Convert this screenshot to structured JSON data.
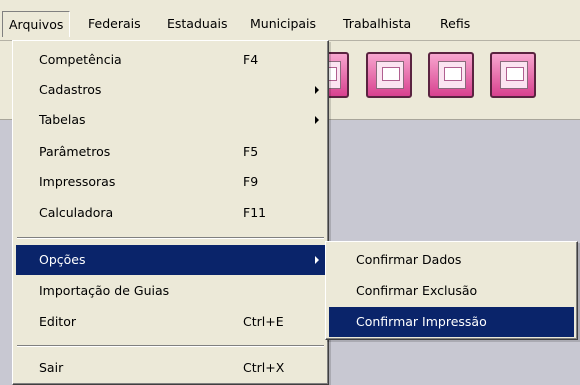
{
  "menubar": {
    "items": [
      {
        "label": "Arquivos"
      },
      {
        "label": "Federais"
      },
      {
        "label": "Estaduais"
      },
      {
        "label": "Municipais"
      },
      {
        "label": "Trabalhista"
      },
      {
        "label": "Refis"
      }
    ]
  },
  "toolbar": {
    "buttons": [
      {
        "icon": "document-icon"
      },
      {
        "icon": "money-icon"
      },
      {
        "icon": "fgts-icon"
      },
      {
        "icon": "edit-icon"
      }
    ]
  },
  "file_menu": {
    "items": [
      {
        "label": "Competência",
        "shortcut": "F4"
      },
      {
        "label": "Cadastros",
        "shortcut": ""
      },
      {
        "label": "Tabelas",
        "shortcut": ""
      },
      {
        "label": "Parâmetros",
        "shortcut": "F5"
      },
      {
        "label": "Impressoras",
        "shortcut": "F9"
      },
      {
        "label": "Calculadora",
        "shortcut": "F11"
      },
      {
        "label": "Opções",
        "shortcut": ""
      },
      {
        "label": "Importação de Guias",
        "shortcut": ""
      },
      {
        "label": "Editor",
        "shortcut": "Ctrl+E"
      },
      {
        "label": "Sair",
        "shortcut": "Ctrl+X"
      }
    ]
  },
  "options_submenu": {
    "items": [
      {
        "label": "Confirmar Dados"
      },
      {
        "label": "Confirmar Exclusão"
      },
      {
        "label": "Confirmar Impressão"
      }
    ]
  },
  "colors": {
    "selection": "#0a246a",
    "menu_bg": "#ece9d8",
    "toolbar_button": "#d8418f",
    "workspace": "#c8c8d2"
  }
}
